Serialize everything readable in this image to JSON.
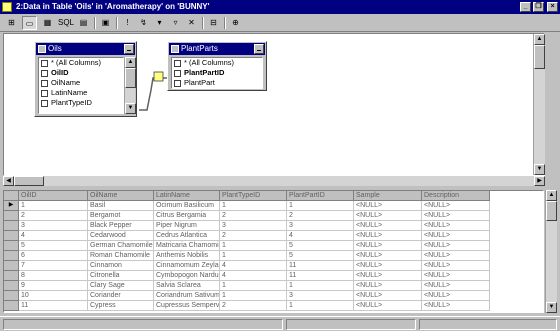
{
  "window": {
    "title": "2:Data in Table 'Oils' in 'Aromatherapy' on 'BUNNY'"
  },
  "toolbar": {
    "buttons": [
      {
        "icon": "sql-mode-icon",
        "glyph": "⊞"
      },
      {
        "icon": "diagram-pane-icon",
        "glyph": "▭",
        "pressed": true
      },
      {
        "icon": "grid-pane-icon",
        "glyph": "▦"
      },
      {
        "icon": "sql-pane-icon",
        "glyph": "SQL"
      },
      {
        "icon": "results-pane-icon",
        "glyph": "▤"
      },
      {
        "icon": "properties-icon",
        "glyph": "▣"
      },
      {
        "icon": "run-icon",
        "glyph": "!"
      },
      {
        "icon": "verify-sql-icon",
        "glyph": "↯"
      },
      {
        "icon": "sort-ascending-icon",
        "glyph": "▾"
      },
      {
        "icon": "sort-descending-icon",
        "glyph": "▿"
      },
      {
        "icon": "remove-filter-icon",
        "glyph": "✕"
      },
      {
        "icon": "group-by-icon",
        "glyph": "⊟"
      },
      {
        "icon": "add-table-icon",
        "glyph": "⊕"
      }
    ]
  },
  "tables": {
    "oils": {
      "name": "Oils",
      "columns": [
        {
          "label": "* (All Columns)",
          "bold": false
        },
        {
          "label": "OilID",
          "bold": true
        },
        {
          "label": "OilName",
          "bold": false
        },
        {
          "label": "LatinName",
          "bold": false
        },
        {
          "label": "PlantTypeID",
          "bold": false
        }
      ]
    },
    "plantparts": {
      "name": "PlantParts",
      "columns": [
        {
          "label": "* (All Columns)",
          "bold": false
        },
        {
          "label": "PlantPartID",
          "bold": true
        },
        {
          "label": "PlantPart",
          "bold": false
        }
      ]
    }
  },
  "grid": {
    "headers": [
      "OilID",
      "OilName",
      "LatinName",
      "PlantTypeID",
      "PlantPartID",
      "Sample",
      "Description"
    ],
    "rows": [
      [
        "1",
        "Basil",
        "Ocimum Basilicum",
        "1",
        "1",
        "<NULL>",
        "<NULL>"
      ],
      [
        "2",
        "Bergamot",
        "Citrus Bergamia",
        "2",
        "2",
        "<NULL>",
        "<NULL>"
      ],
      [
        "3",
        "Black Pepper",
        "Piper Nigrum",
        "3",
        "3",
        "<NULL>",
        "<NULL>"
      ],
      [
        "4",
        "Cedarwood",
        "Cedrus Atlantica",
        "2",
        "4",
        "<NULL>",
        "<NULL>"
      ],
      [
        "5",
        "German Chamomile",
        "Matricaria Chamomilla",
        "1",
        "5",
        "<NULL>",
        "<NULL>"
      ],
      [
        "6",
        "Roman Chamomile",
        "Anthemis Nobilis",
        "1",
        "5",
        "<NULL>",
        "<NULL>"
      ],
      [
        "7",
        "Cinnamon",
        "Cinnamomum Zeylanicum",
        "4",
        "11",
        "<NULL>",
        "<NULL>"
      ],
      [
        "8",
        "Citronella",
        "Cymbopogon Nardus",
        "4",
        "11",
        "<NULL>",
        "<NULL>"
      ],
      [
        "9",
        "Clary Sage",
        "Salvia Sclarea",
        "1",
        "1",
        "<NULL>",
        "<NULL>"
      ],
      [
        "10",
        "Coriander",
        "Coriandrum Sativum",
        "1",
        "3",
        "<NULL>",
        "<NULL>"
      ],
      [
        "11",
        "Cypress",
        "Cupressus Sempervirens",
        "2",
        "1",
        "<NULL>",
        "<NULL>"
      ]
    ],
    "current_row": 0
  }
}
